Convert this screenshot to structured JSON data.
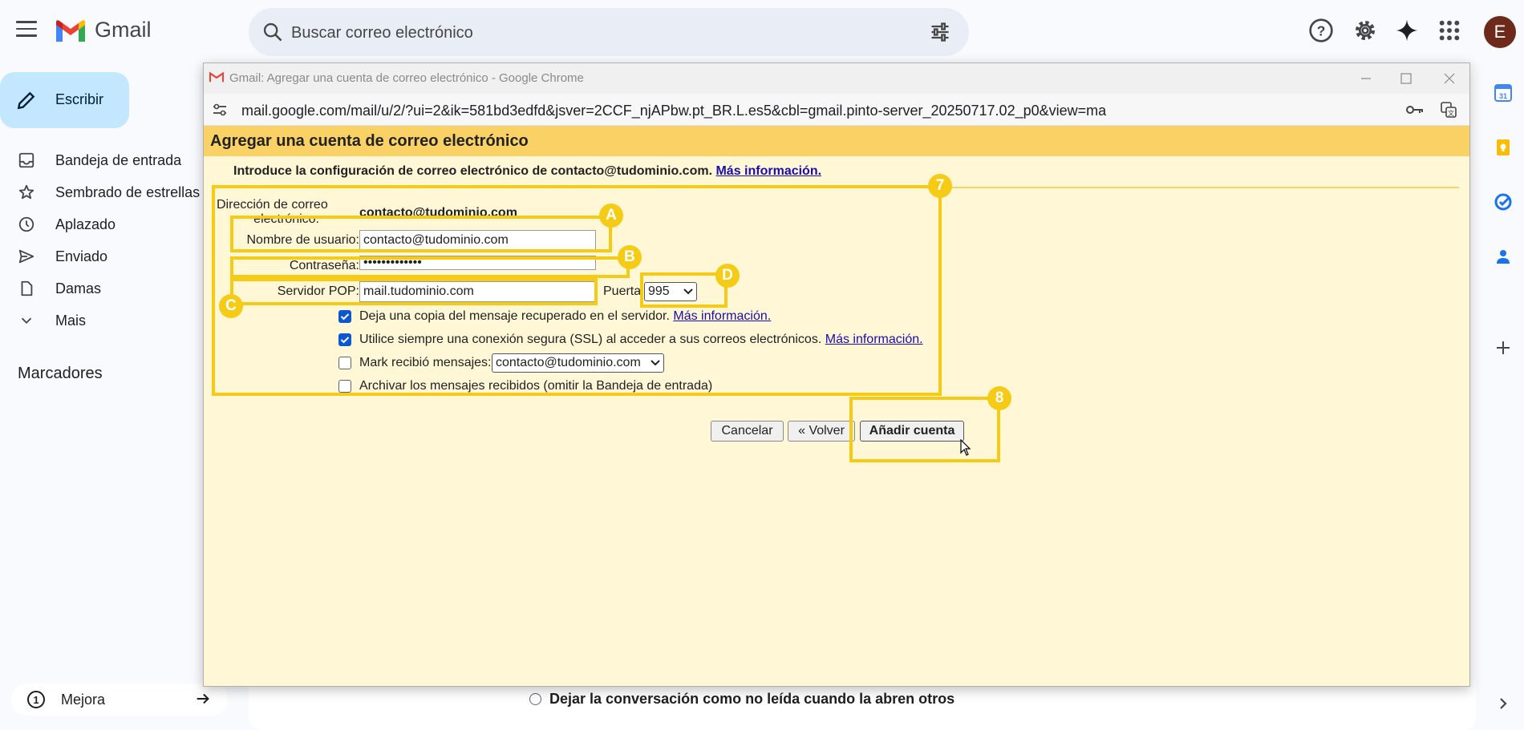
{
  "gmail": {
    "brand": "Gmail",
    "search_placeholder": "Buscar correo electrónico",
    "avatar_letter": "E",
    "compose_label": "Escribir",
    "nav": [
      {
        "label": "Bandeja de entrada",
        "icon": "inbox-icon"
      },
      {
        "label": "Sembrado de estrellas",
        "icon": "star-icon"
      },
      {
        "label": "Aplazado",
        "icon": "clock-icon"
      },
      {
        "label": "Enviado",
        "icon": "send-icon"
      },
      {
        "label": "Damas",
        "icon": "draft-icon"
      },
      {
        "label": "Mais",
        "icon": "chevron-down-icon"
      }
    ],
    "labels_title": "Marcadores",
    "mejora_label": "Mejora",
    "mejora_number": "1",
    "bottom_option": "Dejar la conversación como no leída cuando la abren otros"
  },
  "popup": {
    "window_title": "Gmail: Agregar una cuenta de correo electrónico - Google Chrome",
    "url": "mail.google.com/mail/u/2/?ui=2&ik=581bd3edfd&jsver=2CCF_njAPbw.pt_BR.L.es5&cbl=gmail.pinto-server_20250717.02_p0&view=ma",
    "header": "Agregar una cuenta de correo electrónico",
    "intro_text": "Introduce la configuración de correo electrónico de contacto@tudominio.com.",
    "intro_link": "Más información.",
    "form": {
      "email_label_1": "Dirección de correo",
      "email_label_2": "electrónico:",
      "email_value": "contacto@tudominio.com",
      "username_label": "Nombre de usuario:",
      "username_value": "contacto@tudominio.com",
      "password_label": "Contraseña:",
      "password_value": "•••••••••••••",
      "pop_label": "Servidor POP:",
      "pop_value": "mail.tudominio.com",
      "port_label": "Puerta",
      "port_value": "995",
      "opt_copy": "Deja una copia del mensaje recuperado en el servidor.",
      "opt_copy_link": "Más información.",
      "opt_copy_checked": true,
      "opt_ssl": "Utilice siempre una conexión segura (SSL) al acceder a sus correos electrónicos.",
      "opt_ssl_link": "Más información.",
      "opt_ssl_checked": true,
      "opt_mark": "Mark recibió mensajes:",
      "opt_mark_select": "contacto@tudominio.com",
      "opt_mark_checked": false,
      "opt_archive": "Archivar los mensajes recibidos (omitir la Bandeja de entrada)",
      "opt_archive_checked": false
    },
    "buttons": {
      "cancel": "Cancelar",
      "back": "« Volver",
      "add": "Añadir cuenta"
    }
  },
  "annotations": {
    "badge_7": "7",
    "badge_a": "A",
    "badge_b": "B",
    "badge_c": "C",
    "badge_d": "D",
    "badge_8": "8",
    "color": "#f5cb16"
  },
  "colors": {
    "compose_bg": "#c2e7ff",
    "header_bg": "#fad165",
    "content_bg": "#fff7d6",
    "checkbox": "#0b57d0",
    "link": "#1a0dab"
  }
}
